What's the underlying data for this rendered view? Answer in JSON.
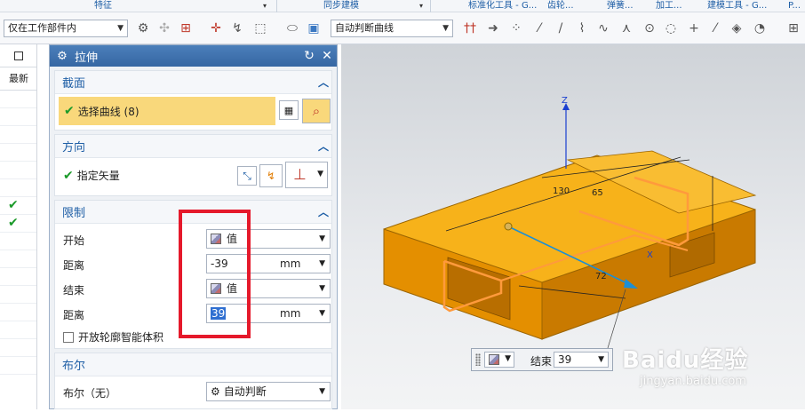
{
  "ribbon": {
    "groups": [
      "特征",
      "同步建模",
      "标准化工具 - G...",
      "齿轮...",
      "弹簧...",
      "加工...",
      "建模工具 - G...",
      "P..."
    ]
  },
  "toolbar": {
    "filter_combo": "仅在工作部件内",
    "curve_rule_combo": "自动判断曲线"
  },
  "navigator": {
    "column_header": "最新",
    "checked_rows": [
      7,
      8
    ]
  },
  "dialog": {
    "title": "拉伸",
    "section": {
      "title": "截面",
      "select_curve": "选择曲线 (8)"
    },
    "direction": {
      "title": "方向",
      "vector_label": "指定矢量"
    },
    "limits": {
      "title": "限制",
      "start_label": "开始",
      "start_option": "值",
      "start_distance_label": "距离",
      "start_distance": "-39",
      "end_label": "结束",
      "end_option": "值",
      "end_distance_label": "距离",
      "end_distance": "39",
      "unit": "mm",
      "open_profile_label": "开放轮廓智能体积"
    },
    "boolean": {
      "title": "布尔",
      "label": "布尔（无）",
      "option": "自动判断"
    }
  },
  "viewport": {
    "model_color": "#f2a100",
    "dimensions": [
      "130",
      "65",
      "72"
    ],
    "axis_labels": [
      "Z",
      "X"
    ],
    "float_bar": {
      "label": "结束",
      "value": "39"
    }
  },
  "watermark": {
    "text": "Baidu经验",
    "url_text": "jingyan.baidu.com"
  },
  "colors": {
    "title_blue": "#3667a3",
    "selection_yellow": "#f9d87b",
    "highlight_red": "#e5192b",
    "check_green": "#1b9a2a"
  }
}
